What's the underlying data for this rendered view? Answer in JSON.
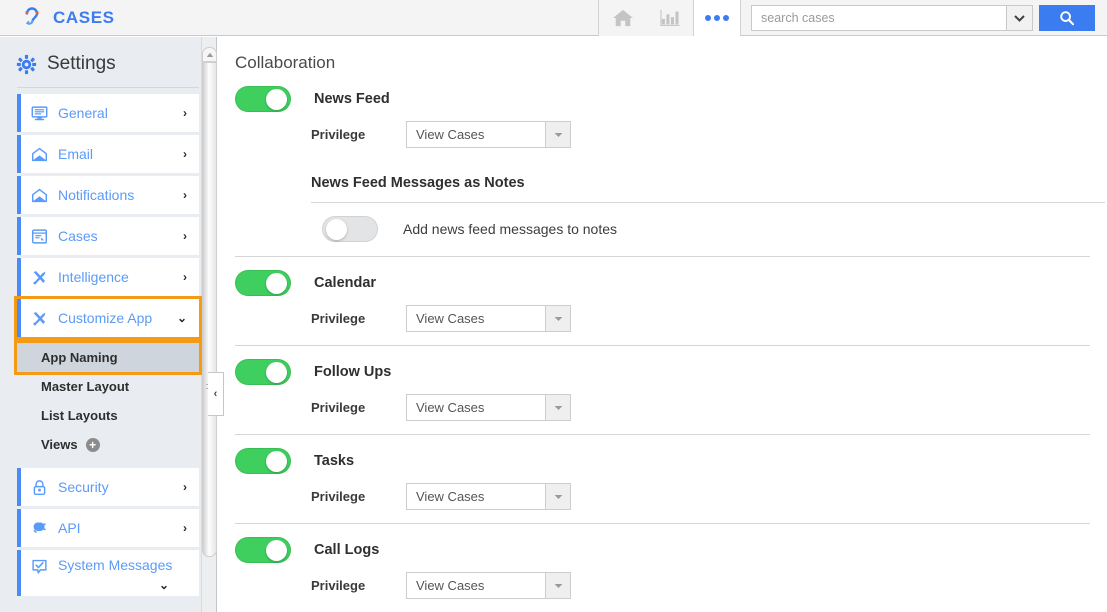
{
  "header": {
    "brand_name": "CASES",
    "logo_icon": "cases-logo-icon",
    "home_icon": "home-icon",
    "reports_icon": "bar-chart-icon",
    "more_icon": "more-dots-icon",
    "search_placeholder": "search cases",
    "search_value": "",
    "search_dropdown_icon": "chevron-down-icon",
    "search_button_icon": "search-icon",
    "accent_blue": "#3b7cf0"
  },
  "sidebar": {
    "title": "Settings",
    "gear_icon": "gear-icon",
    "items": [
      {
        "label": "General",
        "icon": "monitor-icon",
        "chevron": "›",
        "highlighted": false
      },
      {
        "label": "Email",
        "icon": "envelope-open-icon",
        "chevron": "›",
        "highlighted": false
      },
      {
        "label": "Notifications",
        "icon": "envelope-open-icon",
        "chevron": "›",
        "highlighted": false
      },
      {
        "label": "Cases",
        "icon": "case-window-icon",
        "chevron": "›",
        "highlighted": false
      },
      {
        "label": "Intelligence",
        "icon": "tools-icon",
        "chevron": "›",
        "highlighted": false
      },
      {
        "label": "Customize App",
        "icon": "tools-icon",
        "chevron": "⌄",
        "highlighted": true
      }
    ],
    "sub_items": [
      {
        "label": "App Naming",
        "selected": true,
        "has_plus": false
      },
      {
        "label": "Master Layout",
        "selected": false,
        "has_plus": false
      },
      {
        "label": "List Layouts",
        "selected": false,
        "has_plus": false
      },
      {
        "label": "Views",
        "selected": false,
        "has_plus": true,
        "plus_label": "+"
      }
    ],
    "items_after": [
      {
        "label": "Security",
        "icon": "lock-icon",
        "chevron": "›"
      },
      {
        "label": "API",
        "icon": "plug-icon",
        "chevron": "›"
      }
    ],
    "item_last": {
      "label": "System Messages",
      "icon": "check-bubble-icon",
      "chevron": "⌄"
    },
    "scrollbar_up_icon": "scroll-up-arrow-icon",
    "collapse_icon": "chevron-left-icon",
    "highlight_color": "#f59a15",
    "link_color": "#5b9bf8"
  },
  "main": {
    "page_title": "Collaboration",
    "privilege_label": "Privilege",
    "select_arrow_icon": "chevron-down-icon",
    "toggle_on_color": "#3ecf5e",
    "toggle_off_color": "#e3e4e6",
    "sections": [
      {
        "name": "News Feed",
        "enabled": true,
        "privilege_value": "View Cases",
        "sub_heading": "News Feed Messages as Notes",
        "notes_toggle_enabled": false,
        "notes_label": "Add news feed messages to notes"
      },
      {
        "name": "Calendar",
        "enabled": true,
        "privilege_value": "View Cases"
      },
      {
        "name": "Follow Ups",
        "enabled": true,
        "privilege_value": "View Cases"
      },
      {
        "name": "Tasks",
        "enabled": true,
        "privilege_value": "View Cases"
      },
      {
        "name": "Call Logs",
        "enabled": true,
        "privilege_value": "View Cases"
      }
    ]
  }
}
